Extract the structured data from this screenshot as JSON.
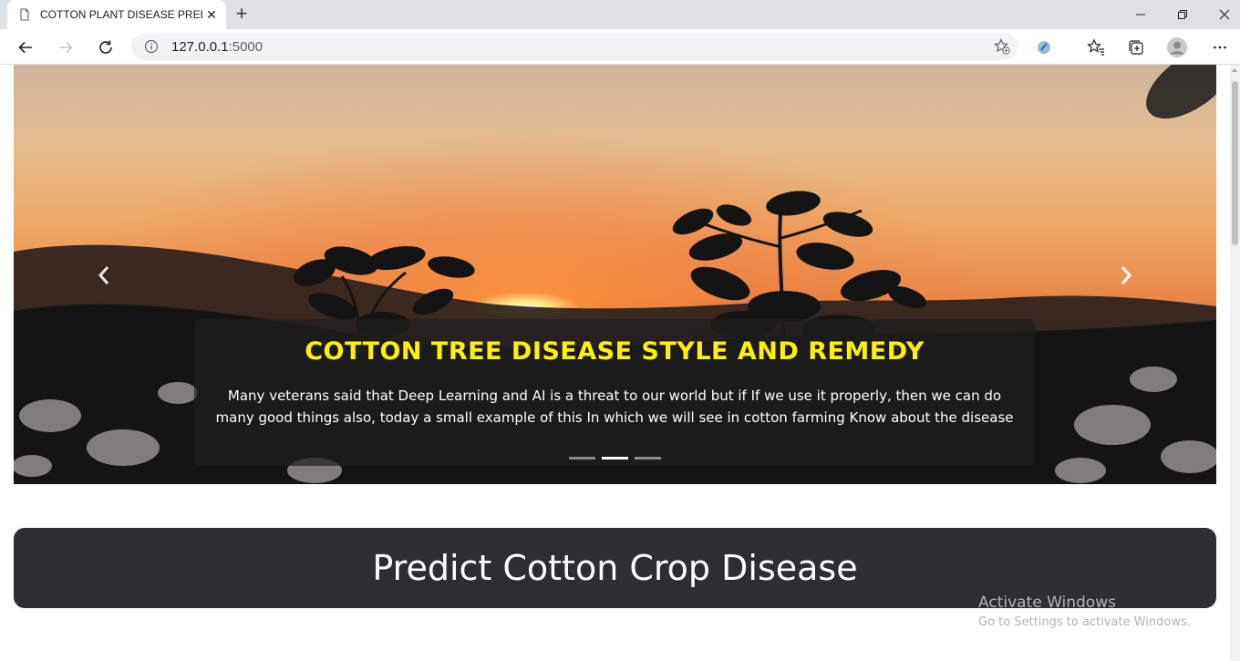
{
  "browser": {
    "tab_title": "COTTON PLANT DISEASE PREDIC",
    "url_host": "127.0.0.1",
    "url_port": ":5000",
    "icons": {
      "page": "document-icon",
      "close": "close-icon",
      "new_tab": "plus-icon",
      "back": "back-arrow-icon",
      "forward": "forward-arrow-icon",
      "refresh": "refresh-icon",
      "info": "info-icon",
      "add_favorite": "add-favorite-icon",
      "extension": "extension-icon",
      "favorites": "favorites-icon",
      "collections": "collections-icon",
      "profile": "profile-icon",
      "menu": "more-icon"
    }
  },
  "carousel": {
    "title": "COTTON TREE DISEASE STYLE AND REMEDY",
    "text": "Many veterans said that Deep Learning and AI is a threat to our world but if If we use it properly, then we can do many good things also, today a small example of this In which we will see in cotton farming Know about the disease",
    "slide_count": 3,
    "active_slide": 2,
    "title_color": "#fff200"
  },
  "predict": {
    "title": "Predict Cotton Crop Disease"
  },
  "watermark": {
    "title": "Activate Windows",
    "subtitle": "Go to Settings to activate Windows."
  }
}
